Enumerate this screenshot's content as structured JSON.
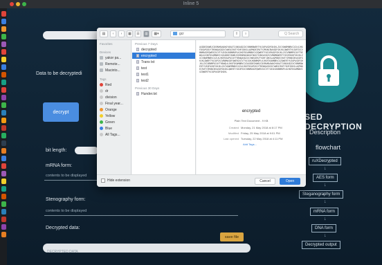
{
  "window": {
    "title": "Inline 5"
  },
  "left": {
    "data_label": "Data to be decryptedi",
    "decrypt_button": "decrypt",
    "bit_length_label": "bit length:",
    "mrna_label": "mRNA form:",
    "mrna_content": "contents to be displayed",
    "steg_label": "Stenography form:",
    "steg_content": "contents to be displayed",
    "decrypted_label": "Decrypted data:",
    "decrypted_placeholder": "DECRYPTED DATA",
    "save_button": "save file"
  },
  "right": {
    "title": "SED DECRYPTION",
    "description": "Description",
    "flowchart": "flowchart",
    "flow_steps": [
      "ruXDecrypted",
      "AES form",
      "Steganography form",
      "mRNA form",
      "DNA form",
      "Decrypted output"
    ]
  },
  "dialog": {
    "toolbar_folder": "gcr",
    "search_placeholder": "Q Search",
    "sidebar": {
      "favorites_head": "Favorites",
      "devices_head": "Devices",
      "devices": [
        "yakor pa...",
        "Remote...",
        "Macinto..."
      ],
      "tags_head": "Tags",
      "tags": [
        {
          "label": "Red",
          "color": "#e0443a"
        },
        {
          "label": "dr",
          "color": "#c9c9c9"
        },
        {
          "label": "division",
          "color": "#c9c9c9"
        },
        {
          "label": "Final year...",
          "color": "#c9c9c9"
        },
        {
          "label": "Orange",
          "color": "#f0952e"
        },
        {
          "label": "Yellow",
          "color": "#f2cf2a"
        },
        {
          "label": "Green",
          "color": "#3db54a"
        },
        {
          "label": "Blue",
          "color": "#3a7fe0"
        },
        {
          "label": "All Tags...",
          "color": "#c9c9c9"
        }
      ]
    },
    "list": {
      "head_recent": "Previous 7 Days",
      "items": [
        "decrypted",
        "encrypted",
        "Trans txt",
        "test",
        "test1",
        "test2"
      ],
      "selected_index": 1,
      "head_older": "Previous 30 Days",
      "older_items": [
        "Hunder.txt"
      ]
    },
    "preview": {
      "cipher_text": "AXDDEIKWBJCDSMAMAXWXOYOKATIXNSASDZXCVBNMQWERTYUIOPASDFGHJKLZXCVQWEMNBVCXZLKJHGFDSAPOIUYTREWQASDZXCVWEOIRUTYGHFJDKSLAQPWOEIRUTYZMXNCBVASDFGHJKLQWERTYUIOPZXCVBNMASDFQWERZXCVTYUIGHJKBNMOPLKJHGFDSAMNBVCXZQWERTYUIOPASDFGHJKLZXCVBNMPOIUYTREWQLKJHGFDSAMNBVCXZAXDDEIKWBJCDSMAMAXWXOYOKATIXNSASDZXCVBNMQWERTYUIOPASDFGHJKLZXCVQWEMNBVCXZLKJHGFDSAPOIUYTREWQASDZXCVWEOIRUTYGHFJDKSLAQPWOEIRUTYZMXNCBVASDFGHJKLQWERTYUIOPZXCVBNMASDFQWERZXCVTYUIGHJKBNMOPLKJHGFDSAMNBVCXZQWERTYUIOPASDFGHJKLZXCVBNMPOIUYTREWQLKJHGFDSAMNBVCXZAXDDEIKWBJCDSMAMAXWXOYOKATIXNSASDZXCVBNMQWERTYUIOPASDFGHJKLZXCVQWEMNBVCXZLKJHGFDSAPOIUYTREWQASDZXCVWEOIRUTYGHFJDKSLAQPWOEIRUTYZMXNCBVASDFGHJKLQWERTYUIOPZXCVBNMASDFQWERZXCVTYUIGHJKBNMOPLKJHGFDSAMNBVCXZQWERTYUIOPASDFGHJKL",
      "filename": "encrypted",
      "meta": [
        {
          "k": "Plain Text Document - 9 KB",
          "v": ""
        },
        {
          "k": "Created",
          "v": "Monday, 21 May 2018 at 8:17 PM"
        },
        {
          "k": "Modified",
          "v": "Friday, 25 May 2018 at 9:01 PM"
        },
        {
          "k": "Last opened",
          "v": "Tuesday, 22 May 2018 at 4:11 PM"
        }
      ],
      "add_tags": "Add Tags..."
    },
    "hide_extension": "Hide extension",
    "cancel": "Cancel",
    "open": "Open"
  }
}
